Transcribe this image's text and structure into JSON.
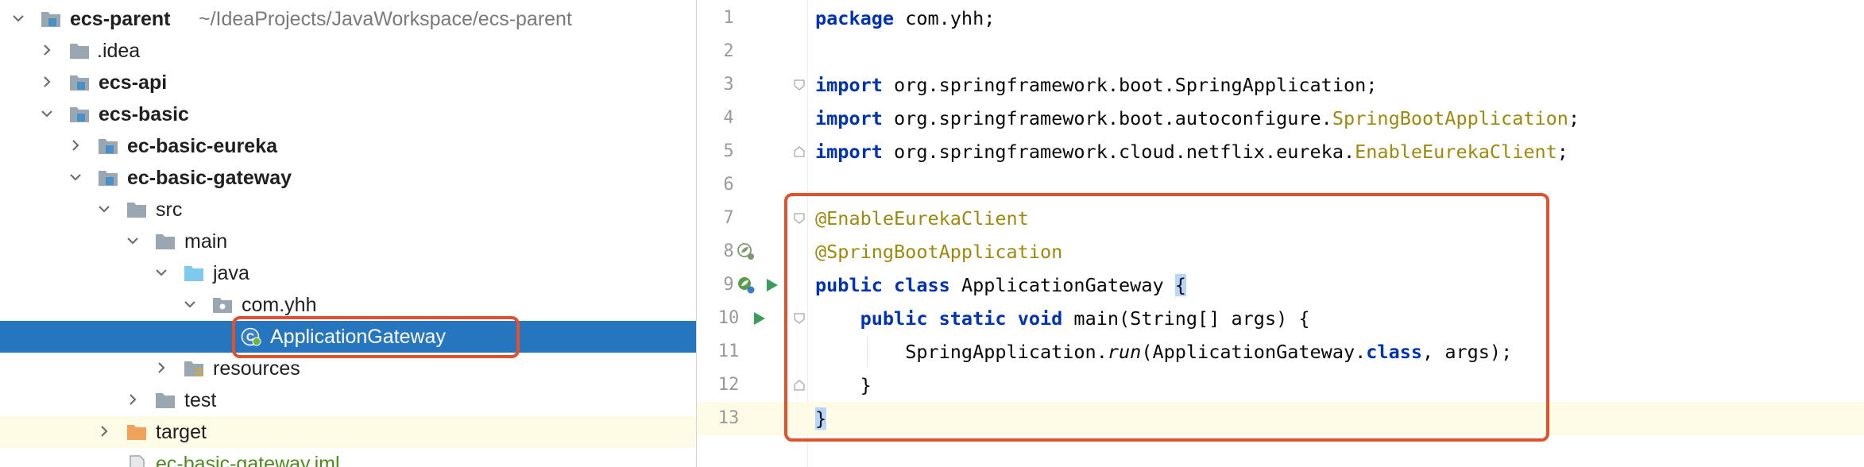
{
  "project_tree": {
    "items": [
      {
        "label": "ecs-parent",
        "path": "~/IdeaProjects/JavaWorkspace/ecs-parent",
        "icon": "module-folder-icon",
        "expanded": true
      },
      {
        "label": ".idea",
        "icon": "folder-icon",
        "expanded": false
      },
      {
        "label": "ecs-api",
        "icon": "module-folder-icon",
        "expanded": false
      },
      {
        "label": "ecs-basic",
        "icon": "module-folder-icon",
        "expanded": true
      },
      {
        "label": "ec-basic-eureka",
        "icon": "module-folder-icon",
        "expanded": false
      },
      {
        "label": "ec-basic-gateway",
        "icon": "module-folder-icon",
        "expanded": true
      },
      {
        "label": "src",
        "icon": "folder-icon",
        "expanded": true
      },
      {
        "label": "main",
        "icon": "folder-icon",
        "expanded": true
      },
      {
        "label": "java",
        "icon": "source-folder-icon",
        "expanded": true
      },
      {
        "label": "com.yhh",
        "icon": "package-icon",
        "expanded": true
      },
      {
        "label": "ApplicationGateway",
        "icon": "spring-boot-class-icon",
        "selected": true
      },
      {
        "label": "resources",
        "icon": "resources-folder-icon",
        "expanded": false
      },
      {
        "label": "test",
        "icon": "folder-icon",
        "expanded": false
      },
      {
        "label": "target",
        "icon": "excluded-folder-icon",
        "expanded": false
      },
      {
        "label": "ec-basic-gateway.iml",
        "icon": "iml-file-icon"
      }
    ]
  },
  "editor": {
    "line_numbers": [
      "1",
      "2",
      "3",
      "4",
      "5",
      "6",
      "7",
      "8",
      "9",
      "10",
      "11",
      "12",
      "13"
    ],
    "line1": {
      "kw": "package",
      "rest": " com.yhh;"
    },
    "line3": {
      "kw": "import",
      "rest": " org.springframework.boot.SpringApplication;"
    },
    "line4": {
      "kw": "import",
      "pkg": " org.springframework.boot.autoconfigure.",
      "cls": "SpringBootApplication",
      "end": ";"
    },
    "line5": {
      "kw": "import",
      "pkg": " org.springframework.cloud.netflix.eureka.",
      "cls": "EnableEurekaClient",
      "end": ";"
    },
    "line7": {
      "ann": "@EnableEurekaClient"
    },
    "line8": {
      "ann": "@SpringBootApplication"
    },
    "line9": {
      "kw1": "public",
      "kw2": "class",
      "name": " ApplicationGateway ",
      "brace": "{"
    },
    "line10": {
      "indent": "    ",
      "kw1": "public",
      "kw2": "static",
      "kw3": "void",
      "rest": " main(String[] args) {"
    },
    "line11": {
      "indent": "        ",
      "pre": "SpringApplication.",
      "method": "run",
      "mid": "(ApplicationGateway.",
      "kw": "class",
      "post": ", args);"
    },
    "line12": {
      "text": "    }"
    },
    "line13": {
      "brace": "}"
    }
  },
  "colors": {
    "selection": "#2675bf",
    "callout": "#e0522d",
    "keyword": "#0033b3",
    "annotation": "#9e880d",
    "current_line": "#fdfbe6"
  }
}
